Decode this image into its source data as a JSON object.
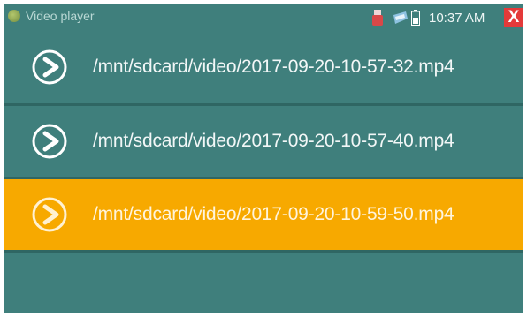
{
  "window": {
    "title": "Video player",
    "time": "10:37 AM",
    "close_label": "X"
  },
  "files": [
    {
      "path": "/mnt/sdcard/video/2017-09-20-10-57-32.mp4",
      "selected": false
    },
    {
      "path": "/mnt/sdcard/video/2017-09-20-10-57-40.mp4",
      "selected": false
    },
    {
      "path": "/mnt/sdcard/video/2017-09-20-10-59-50.mp4",
      "selected": true
    }
  ],
  "colors": {
    "background": "#3f7f7c",
    "selected": "#f7a900",
    "close": "#e43a3a"
  },
  "icons": [
    "app-icon",
    "usb-icon",
    "sd-card-icon",
    "battery-icon",
    "close-icon",
    "play-icon"
  ]
}
